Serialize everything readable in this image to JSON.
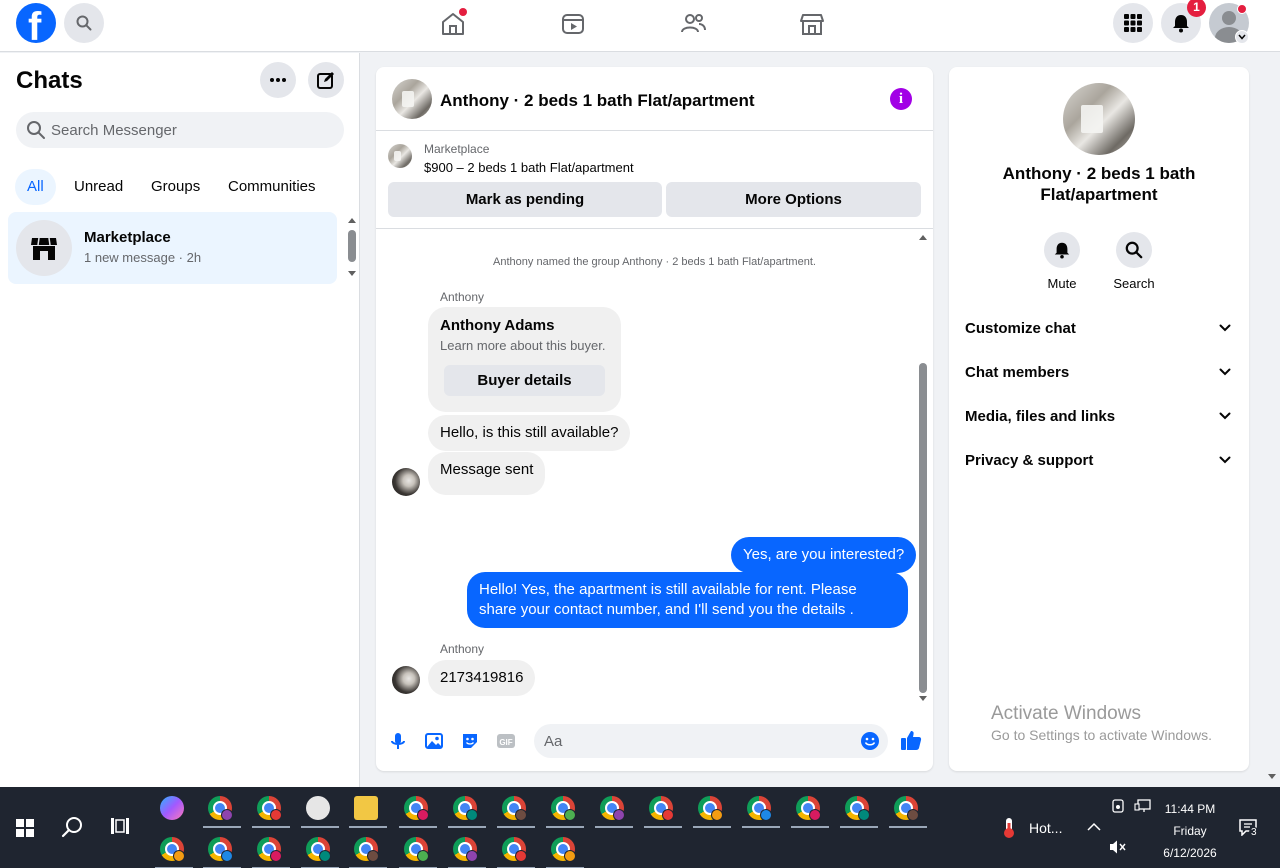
{
  "topbar": {
    "logo_letter": "f",
    "notification_count": "1"
  },
  "chats": {
    "title": "Chats",
    "search_placeholder": "Search Messenger",
    "filters": [
      "All",
      "Unread",
      "Groups",
      "Communities"
    ],
    "active_filter": "All",
    "items": [
      {
        "name": "Marketplace",
        "meta": "1 new message · 2h"
      }
    ]
  },
  "conversation": {
    "title": "Anthony · 2 beds 1 bath Flat/apartment",
    "marketplace_label": "Marketplace",
    "listing": "$900 – 2 beds 1 bath Flat/apartment",
    "mark_pending": "Mark as pending",
    "more_options": "More Options",
    "system_message": "Anthony named the group Anthony · 2 beds 1 bath Flat/apartment.",
    "sender_name": "Anthony",
    "buyer_card": {
      "name": "Anthony Adams",
      "subtitle": "Learn more about this buyer.",
      "button": "Buyer details"
    },
    "messages": [
      {
        "from": "in",
        "text": "Hello, is this still available?"
      },
      {
        "from": "in",
        "text": "Message sent"
      },
      {
        "from": "out",
        "text": "Yes, are you interested?"
      },
      {
        "from": "out",
        "text": "Hello! Yes, the apartment is still available for rent. Please share your contact number, and I'll send you the details ."
      },
      {
        "from": "in",
        "text": "2173419816"
      }
    ],
    "composer_placeholder": "Aa"
  },
  "info": {
    "name": "Anthony · 2 beds 1 bath Flat/apartment",
    "actions": [
      "Mute",
      "Search"
    ],
    "sections": [
      "Customize chat",
      "Chat members",
      "Media, files and links",
      "Privacy & support"
    ]
  },
  "watermark": {
    "line1": "Activate Windows",
    "line2": "Go to Settings to activate Windows."
  },
  "taskbar": {
    "weather": "Hot...",
    "time": "11:44 PM",
    "day": "Friday",
    "date": "6/12/2026",
    "notification_count": "3"
  },
  "colors": {
    "brand_blue": "#0866ff",
    "info_purple": "#a200e6",
    "badge_red": "#e41e3f",
    "taskbar_bg": "#1f2530"
  },
  "icons": {
    "logo": "facebook-logo",
    "nav": [
      "home-icon",
      "video-icon",
      "friends-icon",
      "marketplace-icon"
    ],
    "composer": [
      "microphone-icon",
      "photo-icon",
      "sticker-icon",
      "gif-icon"
    ]
  }
}
